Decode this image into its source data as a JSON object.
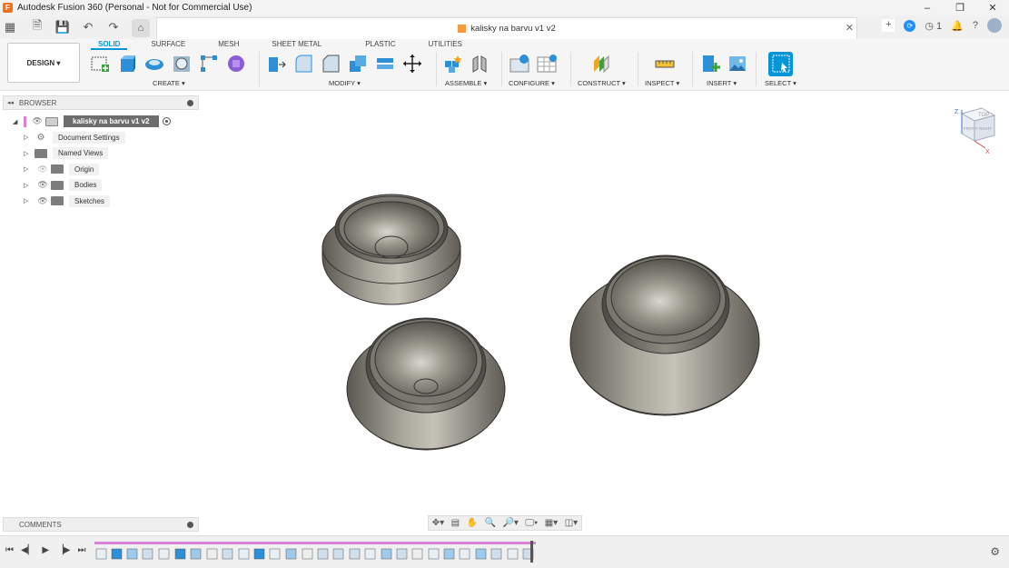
{
  "window": {
    "title": "Autodesk Fusion 360 (Personal - Not for Commercial Use)",
    "app_icon": "fusion-logo-icon",
    "accent_color": "#f37021"
  },
  "tabs": {
    "active_document": "kalisky na barvu v1 v2",
    "job_count": "1"
  },
  "toolbar": {
    "workspace_label": "DESIGN ▾",
    "mode_tabs": [
      "SOLID",
      "SURFACE",
      "MESH",
      "SHEET METAL",
      "PLASTIC",
      "UTILITIES"
    ],
    "active_mode": "SOLID",
    "groups": {
      "create": "CREATE ▾",
      "modify": "MODIFY ▾",
      "assemble": "ASSEMBLE ▾",
      "configure": "CONFIGURE ▾",
      "construct": "CONSTRUCT ▾",
      "inspect": "INSPECT ▾",
      "insert": "INSERT ▾",
      "select": "SELECT ▾"
    },
    "accent_color": "#0696d7"
  },
  "browser": {
    "header": "BROWSER",
    "root": "kalisky na barvu v1 v2",
    "items": [
      {
        "label": "Document Settings",
        "icon": "gear-icon"
      },
      {
        "label": "Named Views",
        "icon": "folder-icon"
      },
      {
        "label": "Origin",
        "icon": "folder-icon"
      },
      {
        "label": "Bodies",
        "icon": "folder-icon"
      },
      {
        "label": "Sketches",
        "icon": "folder-icon"
      }
    ]
  },
  "comments": {
    "header": "COMMENTS"
  },
  "viewcube": {
    "face_top": "TOP",
    "face_front": "FRONT",
    "face_right": "RIGHT",
    "axis_x": "X",
    "axis_z": "Z"
  }
}
